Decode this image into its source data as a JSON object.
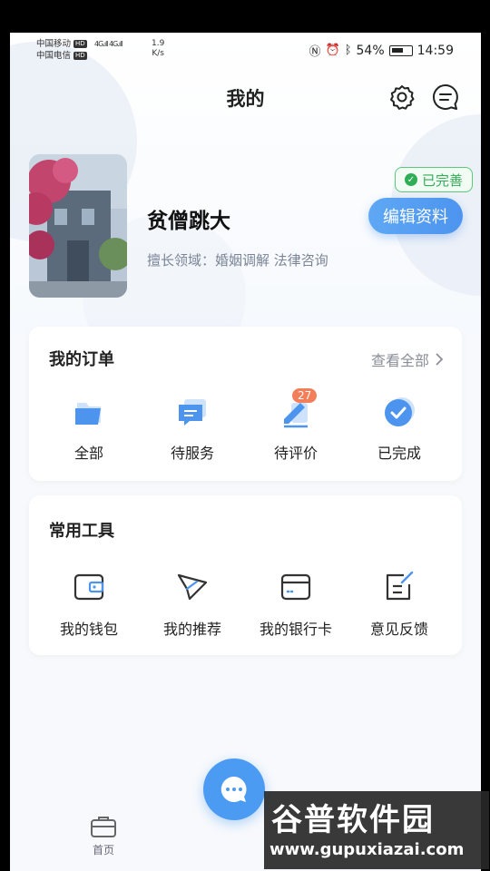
{
  "status_bar": {
    "carrier1": "中国移动",
    "carrier2": "中国电信",
    "hd": "HD",
    "net": "4G",
    "speed_value": "1.9",
    "speed_unit": "K/s",
    "battery": "54%",
    "time": "14:59"
  },
  "header": {
    "title": "我的"
  },
  "profile": {
    "name": "贫僧跳大",
    "specialty": "擅长领域：婚姻调解 法律咨询",
    "status_badge": "已完善",
    "edit_button": "编辑资料"
  },
  "orders": {
    "title": "我的订单",
    "view_all": "查看全部",
    "items": [
      {
        "label": "全部",
        "icon": "folder-icon"
      },
      {
        "label": "待服务",
        "icon": "chat-bubble-icon"
      },
      {
        "label": "待评价",
        "icon": "edit-pen-icon",
        "badge": "27"
      },
      {
        "label": "已完成",
        "icon": "check-circle-icon"
      }
    ]
  },
  "tools": {
    "title": "常用工具",
    "items": [
      {
        "label": "我的钱包",
        "icon": "wallet-icon"
      },
      {
        "label": "我的推荐",
        "icon": "paper-plane-icon"
      },
      {
        "label": "我的银行卡",
        "icon": "bank-card-icon"
      },
      {
        "label": "意见反馈",
        "icon": "feedback-icon"
      }
    ]
  },
  "bottom_nav": {
    "home_label": "首页"
  },
  "watermark": {
    "title": "谷普软件园",
    "url": "www.gupuxiazai.com"
  },
  "colors": {
    "accent": "#4c94ee",
    "success": "#2fae56",
    "badge": "#f27e5a"
  }
}
